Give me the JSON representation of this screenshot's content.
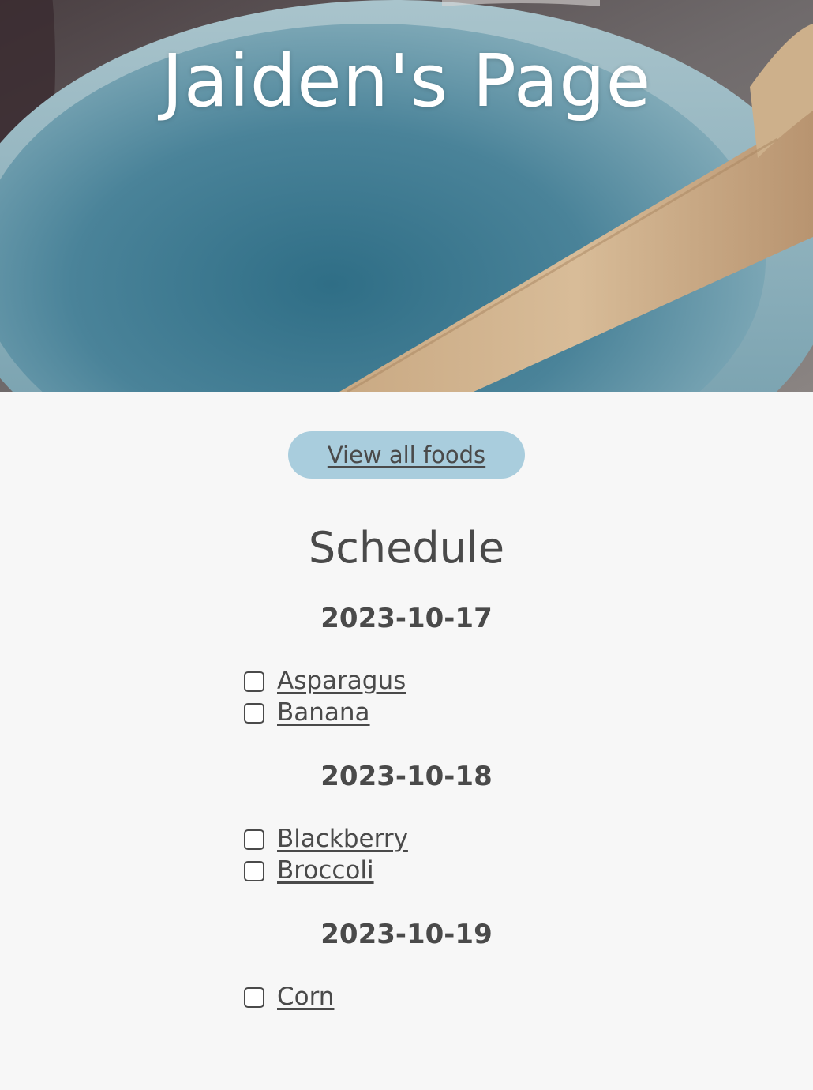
{
  "header": {
    "title": "Jaiden's Page",
    "background_image": "blue-bowl-with-wooden-spoon"
  },
  "actions": {
    "view_all_label": "View all foods"
  },
  "schedule": {
    "title": "Schedule",
    "days": [
      {
        "date": "2023-10-17",
        "foods": [
          "Asparagus",
          "Banana"
        ]
      },
      {
        "date": "2023-10-18",
        "foods": [
          "Blackberry",
          "Broccoli"
        ]
      },
      {
        "date": "2023-10-19",
        "foods": [
          "Corn"
        ]
      }
    ]
  },
  "colors": {
    "page_background": "#f7f7f7",
    "button_background": "#a9cddd",
    "text": "#4a4a4a",
    "hero_title": "#ffffff"
  }
}
